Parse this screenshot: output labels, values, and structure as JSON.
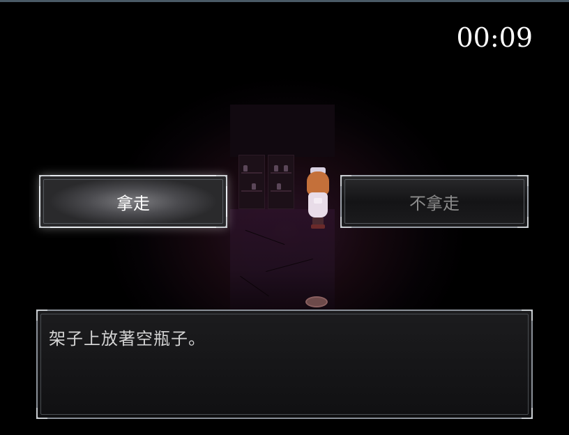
{
  "timer": {
    "text": "00:09"
  },
  "choices": [
    {
      "label": "拿走",
      "state": "selected"
    },
    {
      "label": "不拿走",
      "state": "unselected"
    }
  ],
  "message": {
    "text": "架子上放著空瓶子。"
  },
  "colors": {
    "background": "#000000",
    "room_tint": "#2a1226",
    "selected_text": "#ffffff",
    "unselected_text": "#8c8c8c",
    "frame": "#9aa0a8"
  }
}
